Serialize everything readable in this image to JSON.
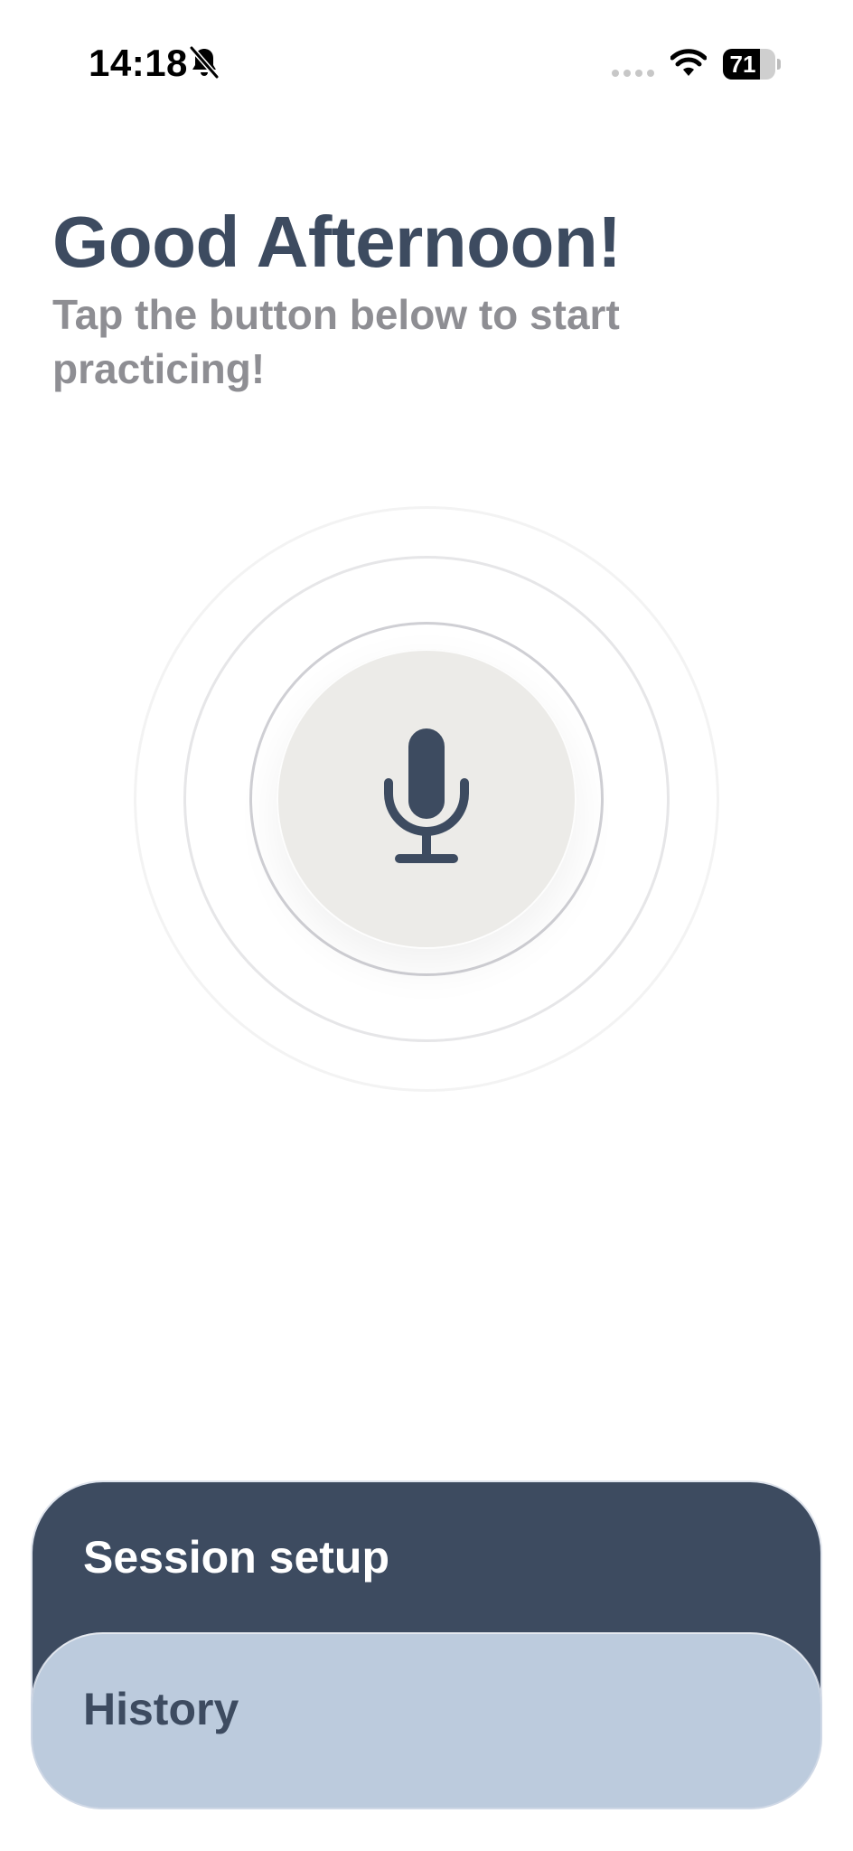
{
  "status_bar": {
    "time": "14:18",
    "battery_level": 71,
    "battery_label": "71",
    "icons": [
      "bell-slash-icon",
      "cellular-signal-icon",
      "wifi-icon",
      "battery-icon"
    ]
  },
  "greeting": {
    "title": "Good Afternoon!",
    "subtitle": "Tap the button below to start practicing!"
  },
  "record": {
    "icon": "microphone-icon"
  },
  "menu": {
    "session_setup_label": "Session setup",
    "history_label": "History"
  },
  "colors": {
    "primary": "#3d4b60",
    "secondary_card": "#bccbdd",
    "mic_button": "#ecebe8",
    "subtitle": "#8e8e93"
  }
}
